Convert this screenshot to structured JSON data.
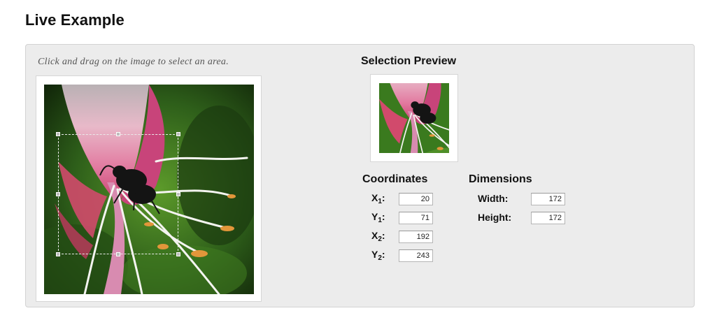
{
  "page": {
    "title": "Live Example"
  },
  "panel": {
    "instructions": "Click and drag on the image to select an area.",
    "preview_title": "Selection Preview"
  },
  "coordinates": {
    "title": "Coordinates",
    "x1": {
      "label": "X",
      "sub": "1",
      "value": "20"
    },
    "y1": {
      "label": "Y",
      "sub": "1",
      "value": "71"
    },
    "x2": {
      "label": "X",
      "sub": "2",
      "value": "192"
    },
    "y2": {
      "label": "Y",
      "sub": "2",
      "value": "243"
    }
  },
  "dimensions": {
    "title": "Dimensions",
    "width": {
      "label": "Width:",
      "value": "172"
    },
    "height": {
      "label": "Height:",
      "value": "172"
    }
  }
}
